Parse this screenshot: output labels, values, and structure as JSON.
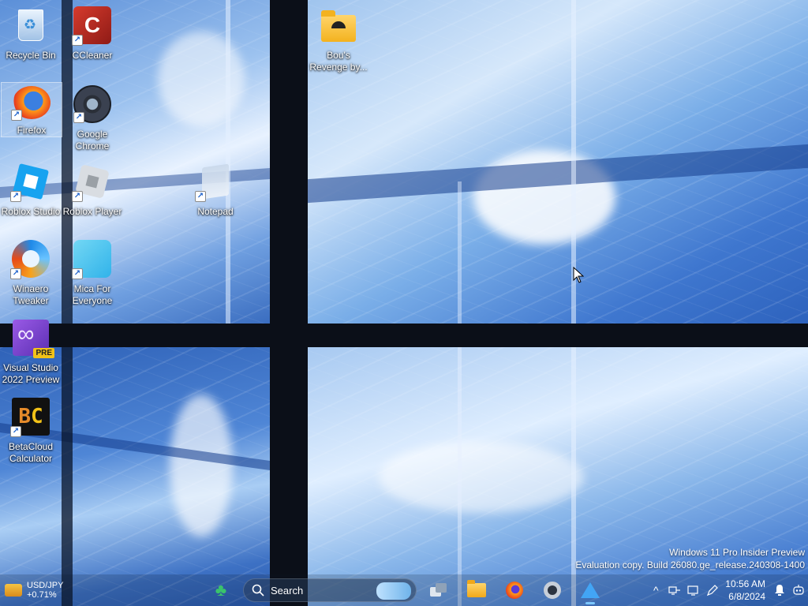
{
  "desktop": {
    "icons": [
      {
        "label": "Recycle Bin"
      },
      {
        "label": "CCleaner"
      },
      {
        "label": "Bou's Revenge by..."
      },
      {
        "label": "Firefox"
      },
      {
        "label": "Google Chrome"
      },
      {
        "label": "Roblox Studio"
      },
      {
        "label": "Roblox Player"
      },
      {
        "label": "Notepad"
      },
      {
        "label": "Winaero Tweaker"
      },
      {
        "label": "Mica For Everyone"
      },
      {
        "label": "Visual Studio 2022 Preview",
        "badge": "PRE"
      },
      {
        "label": "BetaCloud Calculator",
        "glyph_b": "B",
        "glyph_c": "C"
      }
    ],
    "selected_icon": "Firefox",
    "shortcut_glyph": "↗"
  },
  "watermark": {
    "line1": "Windows 11 Pro Insider Preview",
    "line2": "Evaluation copy. Build 26080.ge_release.240308-1400"
  },
  "taskbar": {
    "widget": {
      "pair": "USD/JPY",
      "change": "+0.71%"
    },
    "search": {
      "label": "Search"
    },
    "apps": [
      {
        "icon": "clover-icon"
      },
      {
        "icon": "task-view-icon"
      },
      {
        "icon": "file-explorer-icon"
      },
      {
        "icon": "firefox-icon"
      },
      {
        "icon": "settings-icon"
      },
      {
        "icon": "mica-for-everyone-icon",
        "active": true
      }
    ],
    "tray": {
      "chevron": "^",
      "time": "10:56 AM",
      "date": "6/8/2024"
    }
  },
  "colors": {
    "accent": "#7cc7ff",
    "frame": "#0b0f18",
    "change_up": "#3ac36b"
  }
}
